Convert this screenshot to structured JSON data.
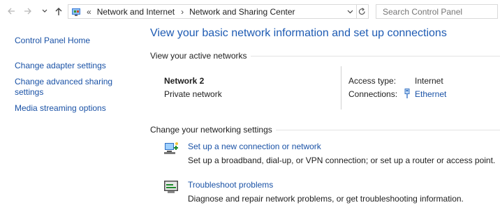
{
  "address": {
    "crumbs": [
      "Network and Internet",
      "Network and Sharing Center"
    ],
    "overflow": "«",
    "search_placeholder": "Search Control Panel"
  },
  "sidebar": {
    "items": [
      {
        "label": "Control Panel Home"
      },
      {
        "label": "Change adapter settings"
      },
      {
        "label": "Change advanced sharing settings"
      },
      {
        "label": "Media streaming options"
      }
    ]
  },
  "main": {
    "title": "View your basic network information and set up connections",
    "active_networks_heading": "View your active networks",
    "network": {
      "name": "Network 2",
      "type": "Private network",
      "access_label": "Access type:",
      "access_value": "Internet",
      "connections_label": "Connections:",
      "connections_value": "Ethernet"
    },
    "settings_heading": "Change your networking settings",
    "tasks": [
      {
        "icon": "new-connection-icon",
        "title": "Set up a new connection or network",
        "desc": "Set up a broadband, dial-up, or VPN connection; or set up a router or access point."
      },
      {
        "icon": "troubleshoot-icon",
        "title": "Troubleshoot problems",
        "desc": "Diagnose and repair network problems, or get troubleshooting information."
      }
    ]
  },
  "colors": {
    "link": "#1a52a6",
    "title": "#1e5bb3"
  }
}
